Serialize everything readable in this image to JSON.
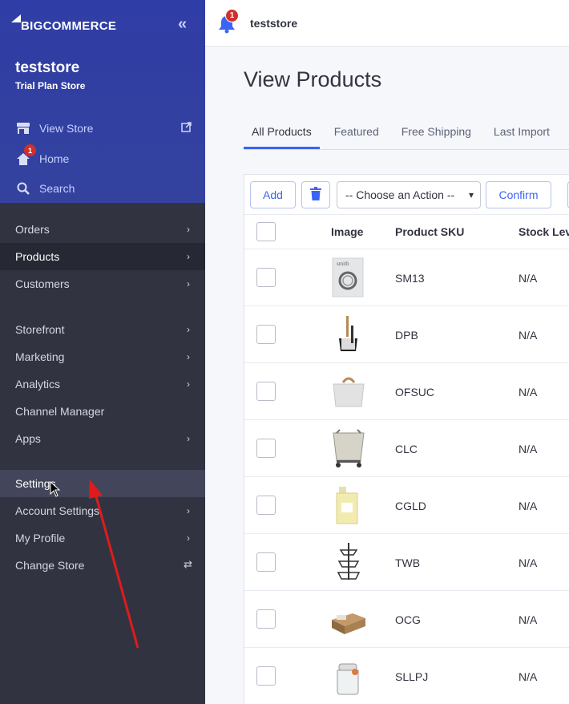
{
  "sidebar": {
    "logo_text": "BIGCOMMERCE",
    "collapse_icon": "double-chevron-left-icon",
    "store_name": "teststore",
    "store_plan": "Trial Plan Store",
    "view_store": "View Store",
    "home": "Home",
    "home_badge": "1",
    "search": "Search",
    "nav": [
      {
        "label": "Orders",
        "has_chevron": true
      },
      {
        "label": "Products",
        "has_chevron": true,
        "state": "active"
      },
      {
        "label": "Customers",
        "has_chevron": true
      },
      {
        "label": "Storefront",
        "has_chevron": true
      },
      {
        "label": "Marketing",
        "has_chevron": true
      },
      {
        "label": "Analytics",
        "has_chevron": true
      },
      {
        "label": "Channel Manager",
        "has_chevron": false
      },
      {
        "label": "Apps",
        "has_chevron": true
      },
      {
        "label": "Settings",
        "has_chevron": false,
        "state": "hover"
      },
      {
        "label": "Account Settings",
        "has_chevron": true
      },
      {
        "label": "My Profile",
        "has_chevron": true
      },
      {
        "label": "Change Store",
        "has_chevron": false
      }
    ]
  },
  "topbar": {
    "notification_badge": "1",
    "store_name": "teststore"
  },
  "main": {
    "title": "View Products",
    "tabs": [
      "All Products",
      "Featured",
      "Free Shipping",
      "Last Import"
    ],
    "active_tab": "All Products",
    "toolbar": {
      "add_label": "Add",
      "action_select": "-- Choose an Action --",
      "confirm_label": "Confirm"
    },
    "table": {
      "columns": [
        "Image",
        "Product SKU",
        "Stock Level"
      ],
      "rows": [
        {
          "sku": "SM13",
          "stock": "N/A",
          "image": "magazine-thumbnail"
        },
        {
          "sku": "DPB",
          "stock": "N/A",
          "image": "dustpan-brush-thumbnail"
        },
        {
          "sku": "OFSUC",
          "stock": "N/A",
          "image": "utility-caddy-thumbnail"
        },
        {
          "sku": "CLC",
          "stock": "N/A",
          "image": "laundry-cart-thumbnail"
        },
        {
          "sku": "CGLD",
          "stock": "N/A",
          "image": "detergent-jug-thumbnail"
        },
        {
          "sku": "TWB",
          "stock": "N/A",
          "image": "tiered-basket-thumbnail"
        },
        {
          "sku": "OCG",
          "stock": "N/A",
          "image": "crate-thumbnail"
        },
        {
          "sku": "SLLPJ",
          "stock": "N/A",
          "image": "glass-jar-thumbnail"
        }
      ]
    }
  },
  "colors": {
    "sidebar_top": "#34429e",
    "sidebar": "#313440",
    "accent": "#3c64f4",
    "badge": "#d0302c",
    "annotation_arrow": "#e01b1b"
  }
}
